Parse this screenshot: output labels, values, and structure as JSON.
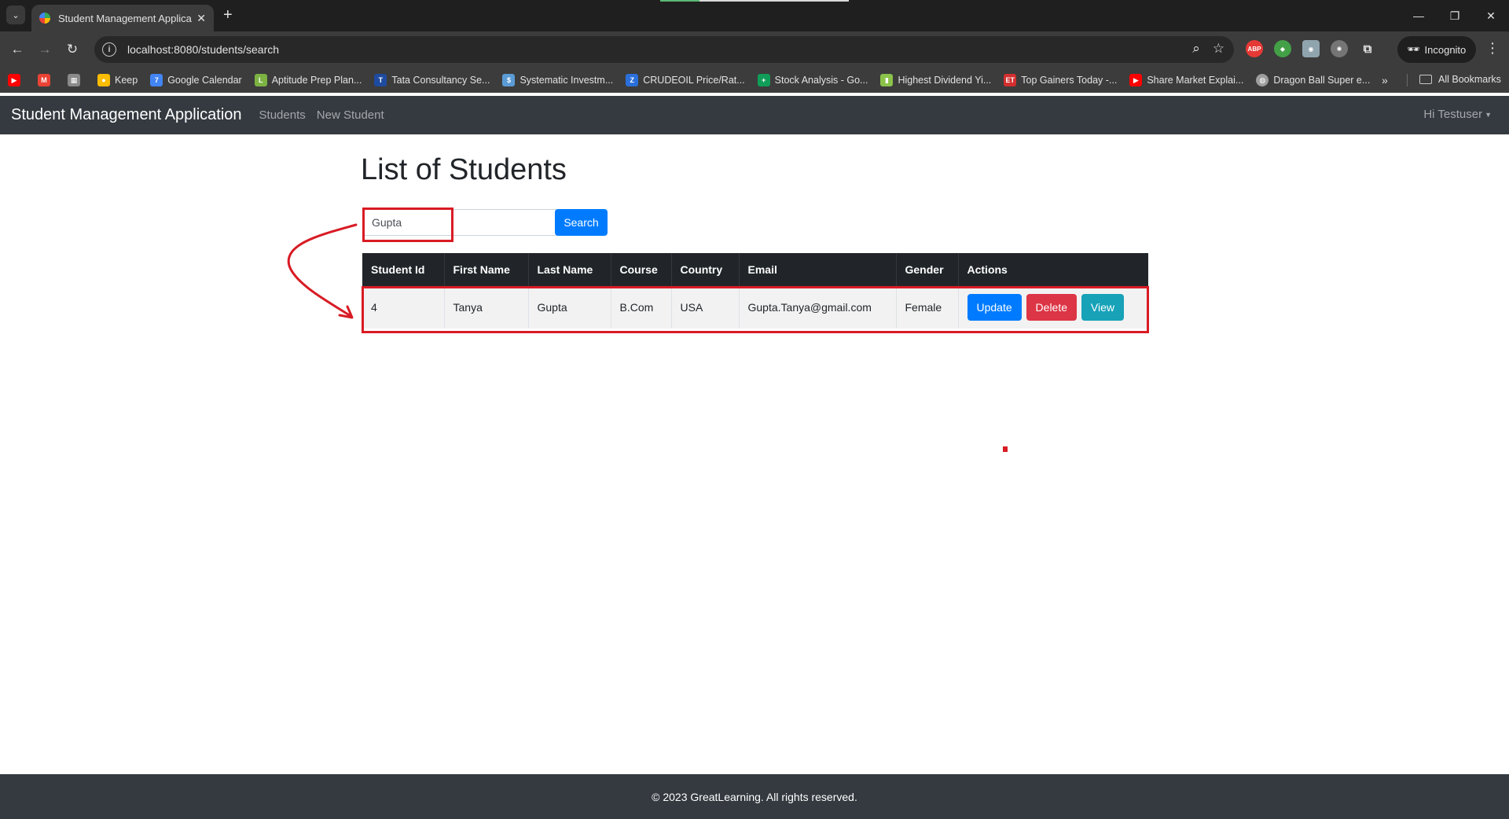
{
  "browser": {
    "tab_title": "Student Management Application",
    "url": "localhost:8080/students/search",
    "incognito_label": "Incognito",
    "bookmarks": [
      {
        "label": "",
        "icon": "youtube-icon",
        "color": "#ff0000"
      },
      {
        "label": "",
        "icon": "gmail-icon",
        "color": "#ea4335"
      },
      {
        "label": "",
        "icon": "calendar-icon",
        "color": "#8a8a8a"
      },
      {
        "label": "Keep",
        "icon": "keep-icon",
        "color": "#fbbc04"
      },
      {
        "label": "Google Calendar",
        "icon": "google-calendar-icon",
        "color": "#4285f4"
      },
      {
        "label": "Aptitude Prep Plan...",
        "icon": "aptitude-icon",
        "color": "#7cb342"
      },
      {
        "label": "Tata Consultancy Se...",
        "icon": "tcs-icon",
        "color": "#1e4ba0"
      },
      {
        "label": "Systematic Investm...",
        "icon": "investment-icon",
        "color": "#5a9bd5"
      },
      {
        "label": "CRUDEOIL Price/Rat...",
        "icon": "crudeoil-icon",
        "color": "#2a6fdb"
      },
      {
        "label": "Stock Analysis - Go...",
        "icon": "sheets-icon",
        "color": "#0f9d58"
      },
      {
        "label": "Highest Dividend Yi...",
        "icon": "bar-chart-icon",
        "color": "#8bc34a"
      },
      {
        "label": "Top Gainers Today -...",
        "icon": "et-icon",
        "color": "#d32f2f"
      },
      {
        "label": "Share Market Explai...",
        "icon": "youtube-icon",
        "color": "#ff0000"
      },
      {
        "label": "Dragon Ball Super e...",
        "icon": "globe-icon",
        "color": "#9e9e9e"
      }
    ],
    "all_bookmarks_label": "All Bookmarks"
  },
  "navbar": {
    "brand": "Student Management Application",
    "links": [
      "Students",
      "New Student"
    ],
    "user_menu": "Hi Testuser"
  },
  "page": {
    "title": "List of Students",
    "search": {
      "value": "Gupta",
      "button_label": "Search"
    },
    "table": {
      "columns": [
        "Student Id",
        "First Name",
        "Last Name",
        "Course",
        "Country",
        "Email",
        "Gender",
        "Actions"
      ],
      "rows": [
        {
          "id": "4",
          "first_name": "Tanya",
          "last_name": "Gupta",
          "course": "B.Com",
          "country": "USA",
          "email": "Gupta.Tanya@gmail.com",
          "gender": "Female",
          "actions": [
            "Update",
            "Delete",
            "View"
          ]
        }
      ]
    }
  },
  "footer": {
    "text": "© 2023 GreatLearning. All rights reserved."
  },
  "colors": {
    "navbar_bg": "#343a40",
    "primary": "#007bff",
    "danger": "#dc3545",
    "info": "#17a2b8",
    "annotation": "#d81b24"
  }
}
